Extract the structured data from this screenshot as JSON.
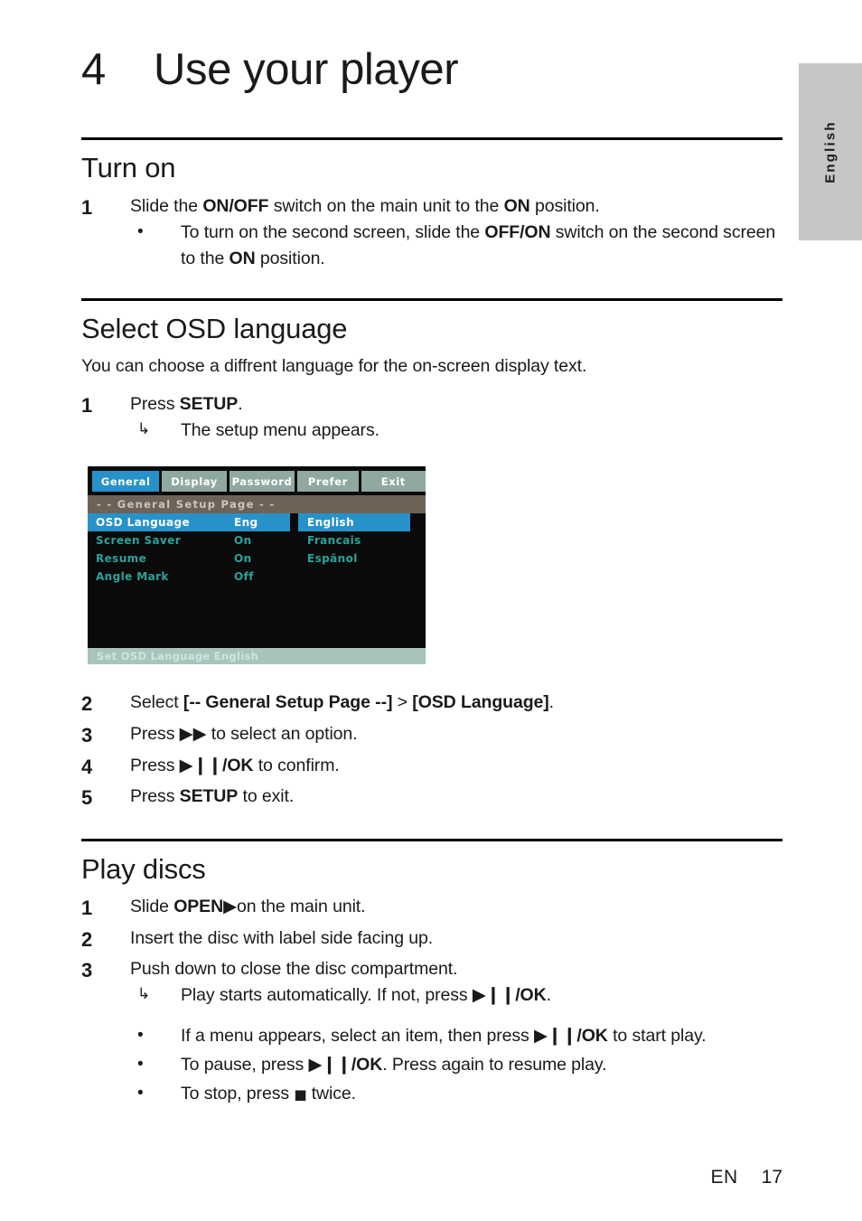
{
  "side_tab": {
    "label": "English"
  },
  "chapter": {
    "number": "4",
    "title": "Use your player"
  },
  "sections": {
    "turn_on": {
      "heading": "Turn on",
      "step1_num": "1",
      "step1_a": "Slide the ",
      "step1_b1": "ON/OFF",
      "step1_c": " switch on the main unit to the ",
      "step1_b2": "ON",
      "step1_d": " position.",
      "bullet_marker": "•",
      "bullet_a": "To turn on the second screen, slide the ",
      "bullet_b1": "OFF/ON",
      "bullet_c": " switch on the second screen to the ",
      "bullet_b2": "ON",
      "bullet_d": " position."
    },
    "osd_language": {
      "heading": "Select OSD language",
      "intro": "You can choose a diffrent language for the on-screen display text.",
      "step1_num": "1",
      "step1_a": "Press ",
      "step1_b": "SETUP",
      "step1_c": ".",
      "arrow_marker": "↳",
      "arrow_text": "The setup menu appears.",
      "step2_num": "2",
      "step2_a": "Select ",
      "step2_b1": "[-- General Setup Page --]",
      "step2_c": " > ",
      "step2_b2": "[OSD Language]",
      "step2_d": ".",
      "step3_num": "3",
      "step3_a": "Press ",
      "step3_glyph": "▶▶",
      "step3_c": " to select an option.",
      "step4_num": "4",
      "step4_a": "Press ",
      "step4_glyph": "▶❙❙",
      "step4_ok": "/OK",
      "step4_c": " to confirm.",
      "step5_num": "5",
      "step5_a": "Press ",
      "step5_b": "SETUP",
      "step5_c": " to exit."
    },
    "play_discs": {
      "heading": "Play discs",
      "step1_num": "1",
      "step1_a": "Slide ",
      "step1_b": "OPEN",
      "step1_glyph": "▶",
      "step1_c": "on the main unit.",
      "step2_num": "2",
      "step2_text": "Insert the disc with label side facing up.",
      "step3_num": "3",
      "step3_text": "Push down to close the disc compartment.",
      "arrow_marker": "↳",
      "arrow_a": "Play starts automatically. If not, press ",
      "arrow_glyph": "▶❙❙",
      "arrow_ok": "/OK",
      "arrow_c": ".",
      "bullet_marker": "•",
      "b1_a": "If a menu appears, select an item, then press ",
      "b1_glyph": "▶❙❙",
      "b1_ok": "/OK",
      "b1_c": " to start play.",
      "b2_a": "To pause, press ",
      "b2_glyph": "▶❙❙",
      "b2_ok": "/OK",
      "b2_c": ". Press again to resume play.",
      "b3_a": "To stop, press ",
      "b3_glyph": "■",
      "b3_c": " twice."
    }
  },
  "osd_menu": {
    "tabs": [
      {
        "label": "General",
        "active": true
      },
      {
        "label": "Display",
        "active": false
      },
      {
        "label": "Password",
        "active": false
      },
      {
        "label": "Prefer",
        "active": false
      },
      {
        "label": "Exit",
        "active": false
      }
    ],
    "page_bar": "- -   General Setup Page   - -",
    "settings": [
      {
        "label": "OSD  Language",
        "value": "Eng",
        "highlighted": true
      },
      {
        "label": "Screen Saver",
        "value": "On",
        "highlighted": false
      },
      {
        "label": "Resume",
        "value": "On",
        "highlighted": false
      },
      {
        "label": "Angle Mark",
        "value": "Off",
        "highlighted": false
      }
    ],
    "options": [
      {
        "label": "English",
        "highlighted": true
      },
      {
        "label": "Francais",
        "highlighted": false
      },
      {
        "label": "Espãnol",
        "highlighted": false
      }
    ],
    "status": "Set OSD Language English",
    "colors": {
      "highlight_blue": "#2792ca",
      "tab_gray": "#8fa9a2",
      "teal_text": "#2aa39c",
      "page_bar": "#6e6257",
      "status_bar": "#a8c4bd",
      "background": "#0a0a0a"
    }
  },
  "footer": {
    "locale": "EN",
    "page": "17"
  }
}
